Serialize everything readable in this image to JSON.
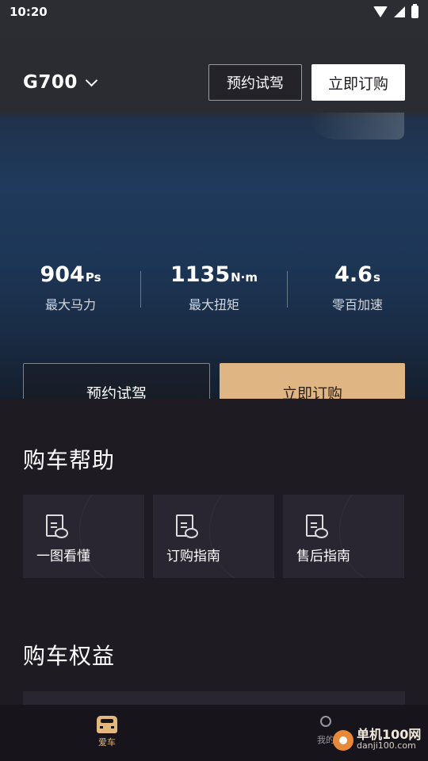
{
  "status_bar": {
    "time": "10:20"
  },
  "top_nav": {
    "model": "G700",
    "test_drive_label": "预约试驾",
    "order_label": "立即订购"
  },
  "specs": [
    {
      "value": "904",
      "unit": "Ps",
      "label": "最大马力"
    },
    {
      "value": "1135",
      "unit": "N·m",
      "label": "最大扭矩"
    },
    {
      "value": "4.6",
      "unit": "s",
      "label": "零百加速"
    }
  ],
  "cta": {
    "test_drive_label": "预约试驾",
    "order_label": "立即订购"
  },
  "purchase_help": {
    "title": "购车帮助",
    "cards": [
      {
        "label": "一图看懂",
        "icon": "document-eye-icon"
      },
      {
        "label": "订购指南",
        "icon": "document-eye-icon"
      },
      {
        "label": "售后指南",
        "icon": "document-car-icon"
      }
    ]
  },
  "purchase_benefits": {
    "title": "购车权益"
  },
  "tab_bar": {
    "home_label": "爱车",
    "mine_label": "我的"
  },
  "watermark": {
    "title": "单机100网",
    "url": "danji100.com"
  },
  "colors": {
    "accent_gold": "#dfb683",
    "background": "#1e1b23",
    "card": "#2a2631"
  }
}
